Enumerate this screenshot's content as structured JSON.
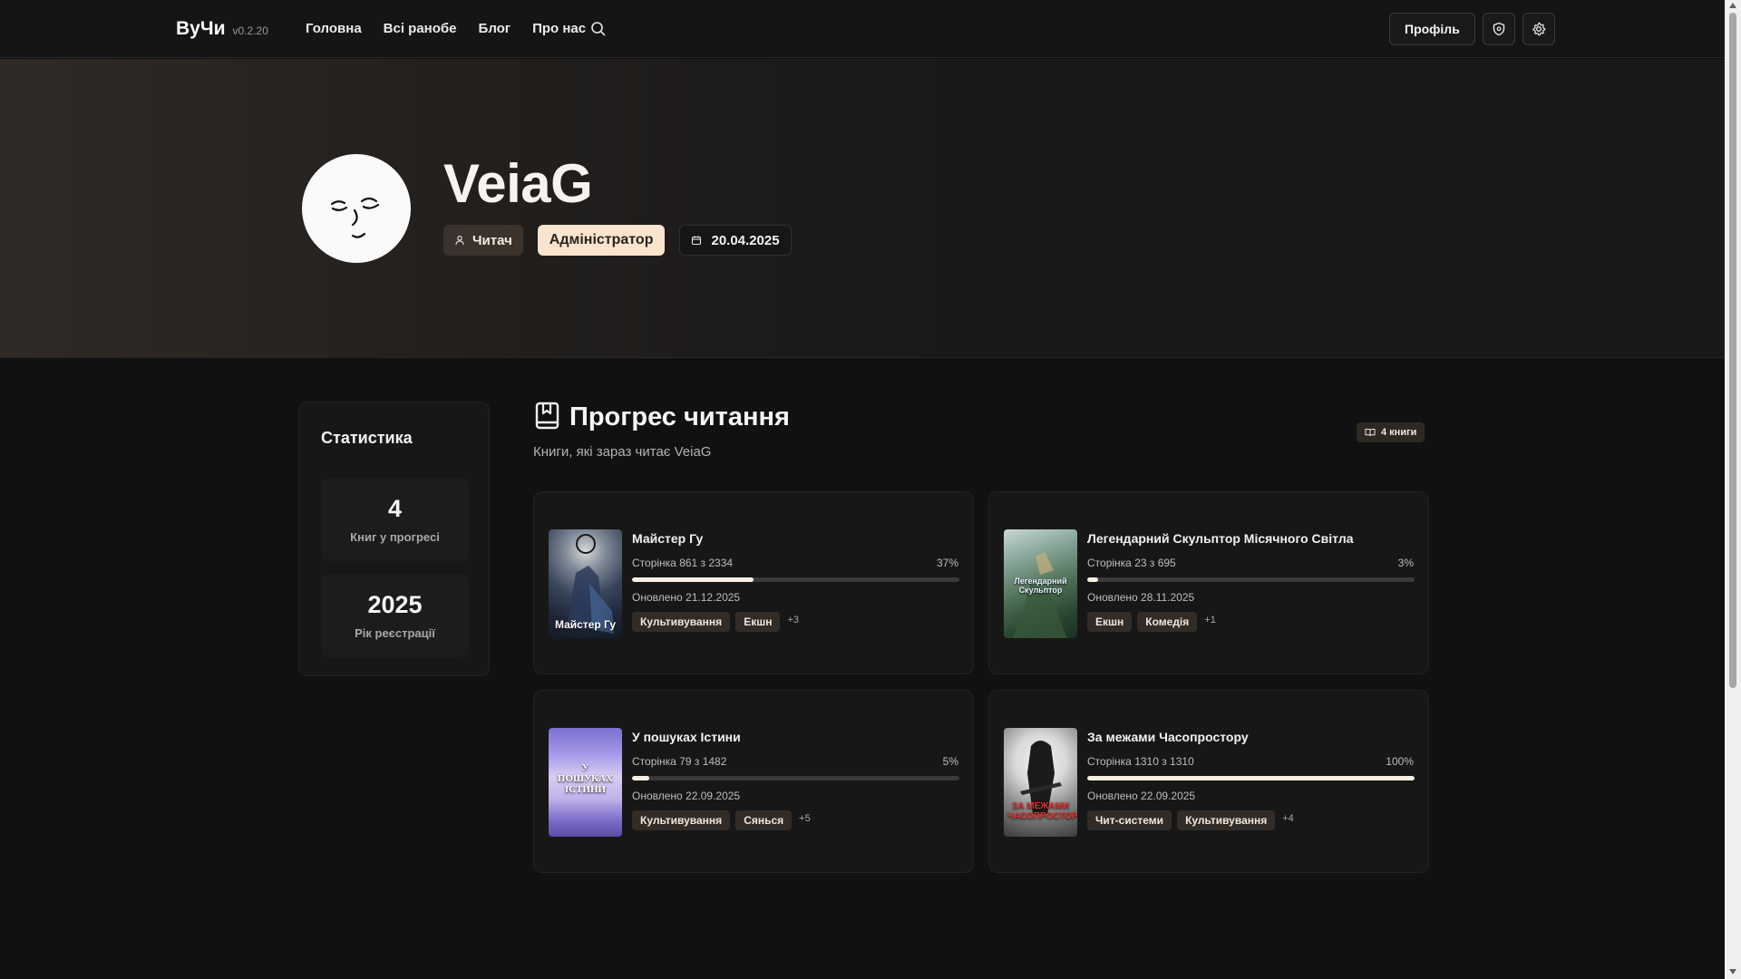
{
  "header": {
    "brand": "ВуЧи",
    "version": "v0.2.20",
    "nav": [
      "Головна",
      "Всі ранобе",
      "Блог",
      "Про нас"
    ],
    "profile_button": "Профіль",
    "icons": [
      "search-icon",
      "shield-icon",
      "gear-icon"
    ]
  },
  "profile": {
    "username": "VeiaG",
    "role_reader": "Читач",
    "role_admin": "Адміністратор",
    "registered": "20.04.2025"
  },
  "stats": {
    "title": "Статистика",
    "items": [
      {
        "value": "4",
        "label": "Книг у прогресі"
      },
      {
        "value": "2025",
        "label": "Рік реєстрації"
      }
    ]
  },
  "reading": {
    "title": "Прогрес читання",
    "subtitle": "Книги, які зараз читає VeiaG",
    "count_label": "4 книги",
    "books": [
      {
        "title": "Майстер Гу",
        "cover_text": "Майстер Гу",
        "pages": "Сторінка 861 з 2334",
        "percent_label": "37%",
        "progress": 0.37,
        "updated": "Оновлено 21.12.2025",
        "tags": [
          "Культивування",
          "Екшн"
        ],
        "more": "+3"
      },
      {
        "title": "Легендарний Скульптор Місячного Світла",
        "cover_text": "Легендарний Скульптор",
        "pages": "Сторінка 23 з 695",
        "percent_label": "3%",
        "progress": 0.033,
        "updated": "Оновлено 28.11.2025",
        "tags": [
          "Екшн",
          "Комедія"
        ],
        "more": "+1"
      },
      {
        "title": "У пошуках Істини",
        "cover_text": "У ПОШУКАХ ІСТИНИ",
        "pages": "Сторінка 79 з 1482",
        "percent_label": "5%",
        "progress": 0.053,
        "updated": "Оновлено 22.09.2025",
        "tags": [
          "Культивування",
          "Сянься"
        ],
        "more": "+5"
      },
      {
        "title": "За межами Часопростору",
        "cover_text": "ЗА МЕЖАМИ ЧАСОПРОСТОРУ",
        "pages": "Сторінка 1310 з 1310",
        "percent_label": "100%",
        "progress": 1.0,
        "updated": "Оновлено 22.09.2025",
        "tags": [
          "Чит-системи",
          "Культивування"
        ],
        "more": "+4"
      }
    ]
  },
  "colors": {
    "background": "#111111",
    "accent": "#fbe4cd",
    "progress_fill": "#f7efe6",
    "tag_bg": "#332c26"
  }
}
